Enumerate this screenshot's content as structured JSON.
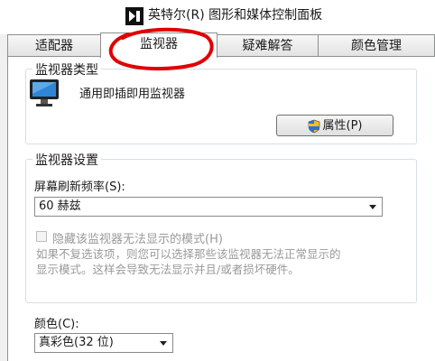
{
  "window": {
    "title": "英特尔(R) 图形和媒体控制面板"
  },
  "tabs": [
    {
      "label": "适配器",
      "active": false
    },
    {
      "label": "监视器",
      "active": true
    },
    {
      "label": "疑难解答",
      "active": false
    },
    {
      "label": "颜色管理",
      "active": false
    }
  ],
  "annotation_color": "#e00000",
  "monitor_type": {
    "title": "监视器类型",
    "monitor_name": "通用即插即用监视器",
    "properties_button": "属性(P)"
  },
  "monitor_settings": {
    "title": "监视器设置",
    "refresh_label": "屏幕刷新频率(S):",
    "refresh_value": "60 赫兹",
    "hide_modes_label": "隐藏该监视器无法显示的模式(H)",
    "hide_modes_checked": false,
    "description_line1": "如果不复选该项，则您可以选择那些该监视器无法正常显示的",
    "description_line2": "显示模式。这样会导致无法显示并且/或者损坏硬件。"
  },
  "colors": {
    "label": "颜色(C):",
    "value": "真彩色(32 位)"
  }
}
